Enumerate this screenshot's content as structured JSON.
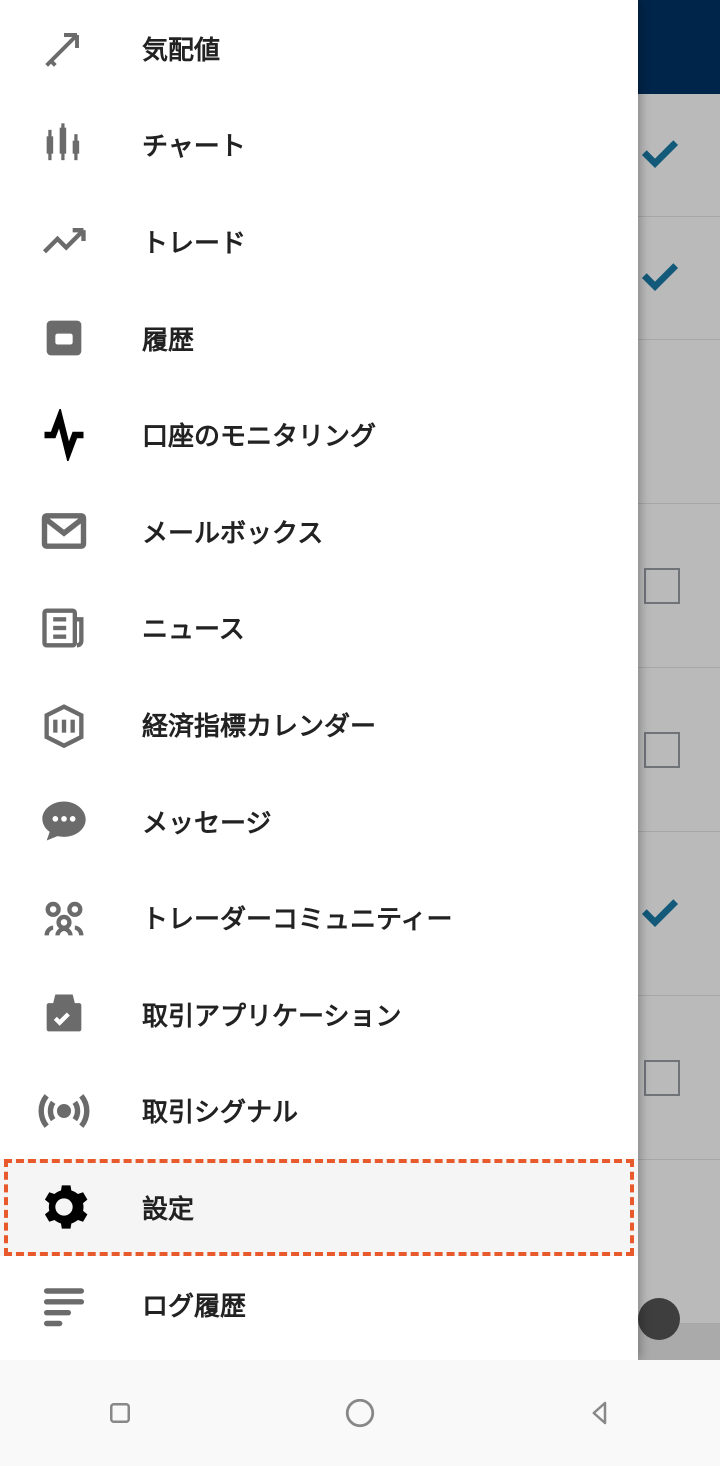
{
  "menu": {
    "items": [
      {
        "key": "quotes",
        "label": "気配値"
      },
      {
        "key": "chart",
        "label": "チャート"
      },
      {
        "key": "trade",
        "label": "トレード"
      },
      {
        "key": "history",
        "label": "履歴"
      },
      {
        "key": "monitoring",
        "label": "口座のモニタリング"
      },
      {
        "key": "mailbox",
        "label": "メールボックス"
      },
      {
        "key": "news",
        "label": "ニュース"
      },
      {
        "key": "calendar",
        "label": "経済指標カレンダー"
      },
      {
        "key": "messages",
        "label": "メッセージ"
      },
      {
        "key": "community",
        "label": "トレーダーコミュニティー"
      },
      {
        "key": "apps",
        "label": "取引アプリケーション"
      },
      {
        "key": "signals",
        "label": "取引シグナル"
      },
      {
        "key": "settings",
        "label": "設定"
      },
      {
        "key": "log",
        "label": "ログ履歴"
      }
    ]
  },
  "background_checks": [
    true,
    true,
    false,
    false,
    true,
    false
  ],
  "colors": {
    "checkmark": "#0d6ea5",
    "icon": "#6b6b6b",
    "highlight_border": "#e8592b"
  }
}
